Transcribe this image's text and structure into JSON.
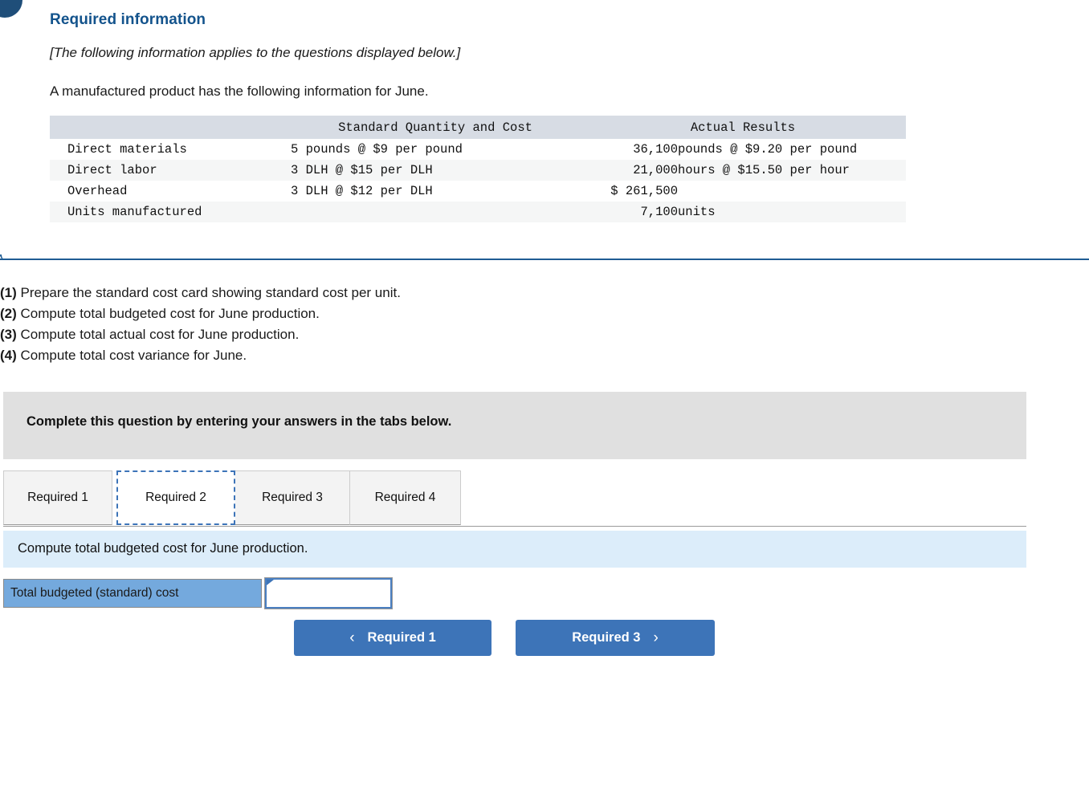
{
  "badge": {
    "name": "question-number-badge"
  },
  "question": {
    "title": "Required information",
    "applies_note": "[The following information applies to the questions displayed below.]",
    "intro": "A manufactured product has the following information for June."
  },
  "info_table": {
    "headers": [
      "",
      "Standard Quantity and Cost",
      "Actual Results"
    ],
    "rows": [
      {
        "label": "Direct materials",
        "standard": "5 pounds @ $9 per pound",
        "actual_number": "36,100",
        "actual_unit": "pounds @ $9.20 per pound"
      },
      {
        "label": "Direct labor",
        "standard": "3 DLH @ $15 per DLH",
        "actual_number": "21,000",
        "actual_unit": "hours @ $15.50 per hour"
      },
      {
        "label": "Overhead",
        "standard": "3 DLH @ $12 per DLH",
        "actual_number": "$ 261,500",
        "actual_unit": ""
      },
      {
        "label": "Units manufactured",
        "standard": "",
        "actual_number": "7,100",
        "actual_unit": "units"
      }
    ]
  },
  "requirements": [
    {
      "num": "(1)",
      "text": " Prepare the standard cost card showing standard cost per unit."
    },
    {
      "num": "(2)",
      "text": " Compute total budgeted cost for June production."
    },
    {
      "num": "(3)",
      "text": " Compute total actual cost for June production."
    },
    {
      "num": "(4)",
      "text": " Compute total cost variance for June."
    }
  ],
  "banner": {
    "text": "Complete this question by entering your answers in the tabs below."
  },
  "tabs": [
    {
      "label": "Required 1",
      "active": false
    },
    {
      "label": "Required 2",
      "active": true
    },
    {
      "label": "Required 3",
      "active": false
    },
    {
      "label": "Required 4",
      "active": false
    }
  ],
  "sub_instruction": {
    "text": "Compute total budgeted cost for June production."
  },
  "answer": {
    "label": "Total budgeted (standard) cost",
    "value": "",
    "placeholder": ""
  },
  "nav": {
    "prev_label": "Required 1",
    "prev_icon": "chevron-left-icon",
    "next_label": "Required 3",
    "next_icon": "chevron-right-icon"
  },
  "colors": {
    "heading_blue": "#13538c",
    "divider_blue": "#1f5c93",
    "table_header_bg": "#d7dce4",
    "table_stripe_bg": "#f5f6f6",
    "banner_grey": "#e0e0e0",
    "sub_instruction_blue": "#dcedfa",
    "answer_label_blue": "#74a9dd",
    "button_blue": "#3d74b8",
    "badge_navy": "#1f4e79"
  }
}
